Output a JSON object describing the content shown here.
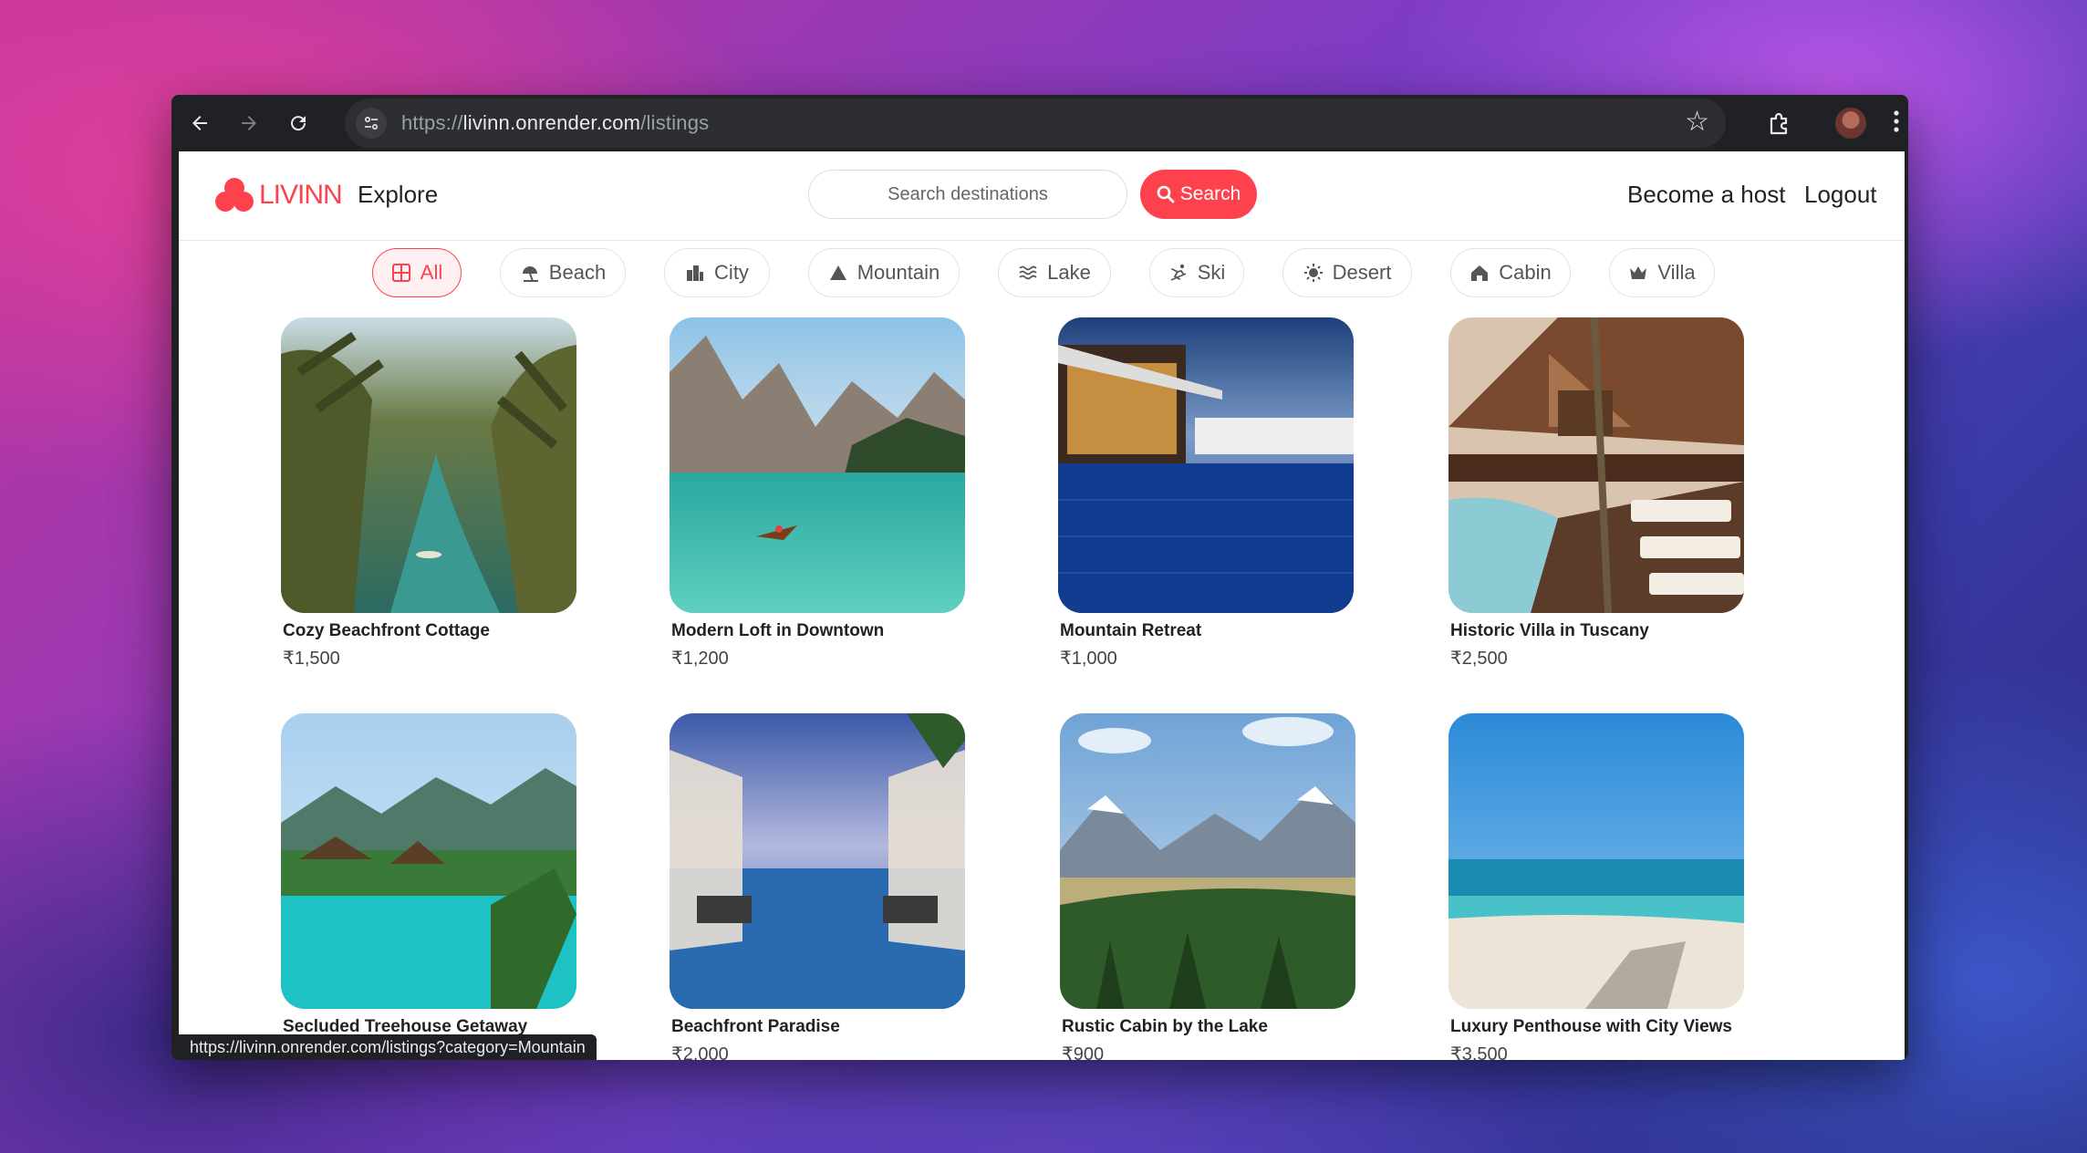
{
  "browser": {
    "url_prefix": "https://",
    "url_host": "livinn.onrender.com",
    "url_path": "/listings",
    "status_url": "https://livinn.onrender.com/listings?category=Mountain",
    "icons": [
      "back-arrow-icon",
      "forward-arrow-icon",
      "reload-icon",
      "site-info-icon",
      "star-icon",
      "extensions-icon",
      "profile-avatar",
      "more-menu-icon"
    ]
  },
  "header": {
    "brand": "LIVINN",
    "explore": "Explore",
    "search_placeholder": "Search destinations",
    "search_button": "Search",
    "become_host": "Become a host",
    "logout": "Logout",
    "accent_color": "#fe424d"
  },
  "filters": [
    {
      "label": "All",
      "icon": "grid-icon",
      "active": true
    },
    {
      "label": "Beach",
      "icon": "umbrella-icon"
    },
    {
      "label": "City",
      "icon": "city-icon"
    },
    {
      "label": "Mountain",
      "icon": "mountain-icon"
    },
    {
      "label": "Lake",
      "icon": "water-icon"
    },
    {
      "label": "Ski",
      "icon": "skier-icon"
    },
    {
      "label": "Desert",
      "icon": "sun-icon"
    },
    {
      "label": "Cabin",
      "icon": "house-icon"
    },
    {
      "label": "Villa",
      "icon": "crown-icon"
    }
  ],
  "listings": [
    {
      "title": "Cozy Beachfront Cottage",
      "price": "₹1,500"
    },
    {
      "title": "Modern Loft in Downtown",
      "price": "₹1,200"
    },
    {
      "title": "Mountain Retreat",
      "price": "₹1,000"
    },
    {
      "title": "Historic Villa in Tuscany",
      "price": "₹2,500"
    },
    {
      "title": "Secluded Treehouse Getaway",
      "price": ""
    },
    {
      "title": "Beachfront Paradise",
      "price": "₹2,000"
    },
    {
      "title": "Rustic Cabin by the Lake",
      "price": "₹900"
    },
    {
      "title": "Luxury Penthouse with City Views",
      "price": "₹3,500"
    }
  ]
}
